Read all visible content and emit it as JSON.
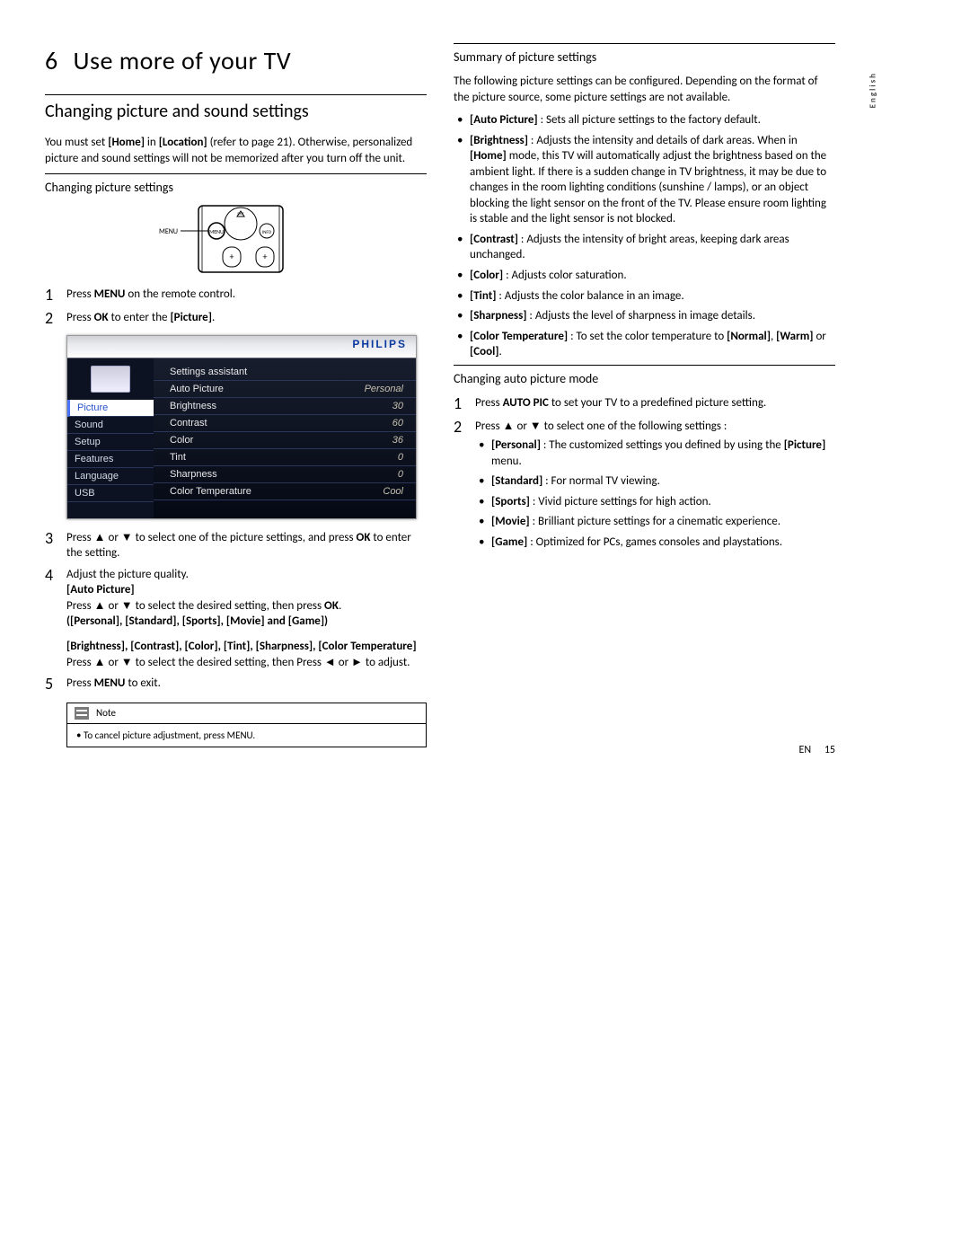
{
  "side_label": "English",
  "chapter": {
    "number": "6",
    "title": "Use more of your TV"
  },
  "section1": {
    "title": "Changing picture and sound settings",
    "intro_parts": {
      "a": "You must set ",
      "home": "[Home]",
      "b": " in ",
      "location": "[Location]",
      "c": " (refer to page 21). Otherwise, personalized picture and sound settings will not be memorized after you turn off the unit."
    }
  },
  "subsection_changing_picture": {
    "title": "Changing picture settings",
    "steps": {
      "s1": {
        "a": "Press ",
        "menu": "MENU",
        "b": " on the remote control."
      },
      "s2": {
        "a": "Press ",
        "ok": "OK",
        "b": " to enter the ",
        "picture": "[Picture]",
        "c": "."
      },
      "s3": {
        "a": "Press ▲ or ▼ to select one of the picture settings, and press ",
        "ok": "OK",
        "b": " to enter the setting."
      },
      "s4": {
        "a": "Adjust the picture quality.",
        "auto_picture": "[Auto Picture]",
        "line1a": "Press ▲ or ▼ to select the desired setting, then press ",
        "ok": "OK",
        "line1b": ".",
        "line1c": "([Personal], [Standard], [Sports], [Movie] and [Game])",
        "group2_label": "[Brightness], [Contrast], [Color], [Tint], [Sharpness], [Color Temperature]",
        "line2": "Press ▲ or ▼ to select the desired setting, then Press ◄ or ► to adjust."
      },
      "s5": {
        "a": "Press ",
        "menu": "MENU",
        "b": " to exit."
      }
    },
    "note": {
      "title": "Note",
      "text": "To cancel picture adjustment, press MENU."
    }
  },
  "osd": {
    "brand": "PHILIPS",
    "nav": [
      "Picture",
      "Sound",
      "Setup",
      "Features",
      "Language",
      "USB"
    ],
    "rows": [
      {
        "label": "Settings assistant",
        "value": ""
      },
      {
        "label": "Auto Picture",
        "value": "Personal"
      },
      {
        "label": "Brightness",
        "value": "30"
      },
      {
        "label": "Contrast",
        "value": "60"
      },
      {
        "label": "Color",
        "value": "36"
      },
      {
        "label": "Tint",
        "value": "0"
      },
      {
        "label": "Sharpness",
        "value": "0"
      },
      {
        "label": "Color Temperature",
        "value": "Cool"
      }
    ]
  },
  "summary": {
    "title": "Summary of picture settings",
    "intro": "The following picture settings can be configured. Depending on the format of the picture source, some picture settings are not available.",
    "items": {
      "auto_picture": {
        "label": "[Auto Picture]",
        "text": " : Sets all picture settings to the factory default."
      },
      "brightness": {
        "label": "[Brightness]",
        "text_a": " : Adjusts the intensity and details of dark areas. When in ",
        "home": "[Home]",
        "text_b": " mode, this TV will automatically adjust the brightness based on the ambient light. If there is a sudden change in TV brightness, it may be due to changes in the room lighting conditions (sunshine / lamps), or an object blocking the light sensor on the front of the TV. Please ensure room lighting is stable and the light sensor is not blocked."
      },
      "contrast": {
        "label": "[Contrast]",
        "text": " : Adjusts the intensity of bright areas, keeping dark areas unchanged."
      },
      "color": {
        "label": "[Color]",
        "text": " : Adjusts color saturation."
      },
      "tint": {
        "label": "[Tint]",
        "text": " : Adjusts the color balance in an image."
      },
      "sharpness": {
        "label": "[Sharpness]",
        "text": " : Adjusts the level of sharpness in image details."
      },
      "colortemp": {
        "label": "[Color Temperature]",
        "text_a": " : To set the color temperature to ",
        "n": "[Normal]",
        "sep1": ", ",
        "w": "[Warm]",
        "sep2": " or ",
        "c": "[Cool]",
        "end": "."
      }
    }
  },
  "auto_mode": {
    "title": "Changing auto picture mode",
    "s1": {
      "a": "Press ",
      "btn": "AUTO PIC",
      "b": " to set your TV to a predefined picture setting."
    },
    "s2": {
      "a": "Press ▲ or ▼ to select one of the following settings :"
    },
    "opts": {
      "personal": {
        "label": "[Personal]",
        "text_a": " : The customized settings you defined by using the ",
        "picture": "[Picture]",
        "text_b": " menu."
      },
      "standard": {
        "label": "[Standard]",
        "text": " : For normal TV viewing."
      },
      "sports": {
        "label": "[Sports]",
        "text": " : Vivid picture settings for high action."
      },
      "movie": {
        "label": "[Movie]",
        "text": " : Brilliant picture settings for a cinematic experience."
      },
      "game": {
        "label": "[Game]",
        "text": " : Optimized for PCs, games consoles and playstations."
      }
    }
  },
  "footer": {
    "lang": "EN",
    "page": "15"
  }
}
